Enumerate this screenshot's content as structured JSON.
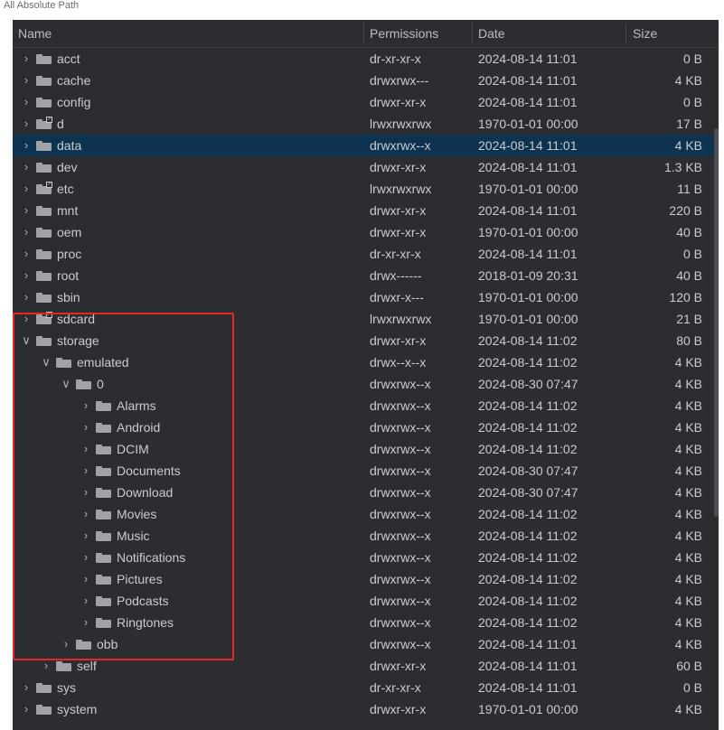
{
  "window": {
    "top_text": "All  Absolute  Path"
  },
  "columns": {
    "name": "Name",
    "permissions": "Permissions",
    "date": "Date",
    "size": "Size"
  },
  "rows": [
    {
      "name": "acct",
      "depth": 0,
      "expanded": false,
      "symlink": false,
      "perm": "dr-xr-xr-x",
      "date": "2024-08-14 11:01",
      "size": "0 B"
    },
    {
      "name": "cache",
      "depth": 0,
      "expanded": false,
      "symlink": false,
      "perm": "drwxrwx---",
      "date": "2024-08-14 11:01",
      "size": "4 KB"
    },
    {
      "name": "config",
      "depth": 0,
      "expanded": false,
      "symlink": false,
      "perm": "drwxr-xr-x",
      "date": "2024-08-14 11:01",
      "size": "0 B"
    },
    {
      "name": "d",
      "depth": 0,
      "expanded": false,
      "symlink": true,
      "perm": "lrwxrwxrwx",
      "date": "1970-01-01 00:00",
      "size": "17 B"
    },
    {
      "name": "data",
      "depth": 0,
      "expanded": false,
      "symlink": false,
      "perm": "drwxrwx--x",
      "date": "2024-08-14 11:01",
      "size": "4 KB",
      "selected": true
    },
    {
      "name": "dev",
      "depth": 0,
      "expanded": false,
      "symlink": false,
      "perm": "drwxr-xr-x",
      "date": "2024-08-14 11:01",
      "size": "1.3 KB"
    },
    {
      "name": "etc",
      "depth": 0,
      "expanded": false,
      "symlink": true,
      "perm": "lrwxrwxrwx",
      "date": "1970-01-01 00:00",
      "size": "11 B"
    },
    {
      "name": "mnt",
      "depth": 0,
      "expanded": false,
      "symlink": false,
      "perm": "drwxr-xr-x",
      "date": "2024-08-14 11:01",
      "size": "220 B"
    },
    {
      "name": "oem",
      "depth": 0,
      "expanded": false,
      "symlink": false,
      "perm": "drwxr-xr-x",
      "date": "1970-01-01 00:00",
      "size": "40 B"
    },
    {
      "name": "proc",
      "depth": 0,
      "expanded": false,
      "symlink": false,
      "perm": "dr-xr-xr-x",
      "date": "2024-08-14 11:01",
      "size": "0 B"
    },
    {
      "name": "root",
      "depth": 0,
      "expanded": false,
      "symlink": false,
      "perm": "drwx------",
      "date": "2018-01-09 20:31",
      "size": "40 B"
    },
    {
      "name": "sbin",
      "depth": 0,
      "expanded": false,
      "symlink": false,
      "perm": "drwxr-x---",
      "date": "1970-01-01 00:00",
      "size": "120 B"
    },
    {
      "name": "sdcard",
      "depth": 0,
      "expanded": false,
      "symlink": true,
      "perm": "lrwxrwxrwx",
      "date": "1970-01-01 00:00",
      "size": "21 B"
    },
    {
      "name": "storage",
      "depth": 0,
      "expanded": true,
      "symlink": false,
      "perm": "drwxr-xr-x",
      "date": "2024-08-14 11:02",
      "size": "80 B"
    },
    {
      "name": "emulated",
      "depth": 1,
      "expanded": true,
      "symlink": false,
      "perm": "drwx--x--x",
      "date": "2024-08-14 11:02",
      "size": "4 KB"
    },
    {
      "name": "0",
      "depth": 2,
      "expanded": true,
      "symlink": false,
      "perm": "drwxrwx--x",
      "date": "2024-08-30 07:47",
      "size": "4 KB"
    },
    {
      "name": "Alarms",
      "depth": 3,
      "expanded": false,
      "symlink": false,
      "perm": "drwxrwx--x",
      "date": "2024-08-14 11:02",
      "size": "4 KB"
    },
    {
      "name": "Android",
      "depth": 3,
      "expanded": false,
      "symlink": false,
      "perm": "drwxrwx--x",
      "date": "2024-08-14 11:02",
      "size": "4 KB"
    },
    {
      "name": "DCIM",
      "depth": 3,
      "expanded": false,
      "symlink": false,
      "perm": "drwxrwx--x",
      "date": "2024-08-14 11:02",
      "size": "4 KB"
    },
    {
      "name": "Documents",
      "depth": 3,
      "expanded": false,
      "symlink": false,
      "perm": "drwxrwx--x",
      "date": "2024-08-30 07:47",
      "size": "4 KB"
    },
    {
      "name": "Download",
      "depth": 3,
      "expanded": false,
      "symlink": false,
      "perm": "drwxrwx--x",
      "date": "2024-08-30 07:47",
      "size": "4 KB"
    },
    {
      "name": "Movies",
      "depth": 3,
      "expanded": false,
      "symlink": false,
      "perm": "drwxrwx--x",
      "date": "2024-08-14 11:02",
      "size": "4 KB"
    },
    {
      "name": "Music",
      "depth": 3,
      "expanded": false,
      "symlink": false,
      "perm": "drwxrwx--x",
      "date": "2024-08-14 11:02",
      "size": "4 KB"
    },
    {
      "name": "Notifications",
      "depth": 3,
      "expanded": false,
      "symlink": false,
      "perm": "drwxrwx--x",
      "date": "2024-08-14 11:02",
      "size": "4 KB"
    },
    {
      "name": "Pictures",
      "depth": 3,
      "expanded": false,
      "symlink": false,
      "perm": "drwxrwx--x",
      "date": "2024-08-14 11:02",
      "size": "4 KB"
    },
    {
      "name": "Podcasts",
      "depth": 3,
      "expanded": false,
      "symlink": false,
      "perm": "drwxrwx--x",
      "date": "2024-08-14 11:02",
      "size": "4 KB"
    },
    {
      "name": "Ringtones",
      "depth": 3,
      "expanded": false,
      "symlink": false,
      "perm": "drwxrwx--x",
      "date": "2024-08-14 11:02",
      "size": "4 KB"
    },
    {
      "name": "obb",
      "depth": 2,
      "expanded": false,
      "symlink": false,
      "perm": "drwxrwx--x",
      "date": "2024-08-14 11:01",
      "size": "4 KB"
    },
    {
      "name": "self",
      "depth": 1,
      "expanded": false,
      "symlink": false,
      "perm": "drwxr-xr-x",
      "date": "2024-08-14 11:01",
      "size": "60 B"
    },
    {
      "name": "sys",
      "depth": 0,
      "expanded": false,
      "symlink": false,
      "perm": "dr-xr-xr-x",
      "date": "2024-08-14 11:01",
      "size": "0 B"
    },
    {
      "name": "system",
      "depth": 0,
      "expanded": false,
      "symlink": false,
      "perm": "drwxr-xr-x",
      "date": "1970-01-01 00:00",
      "size": "4 KB"
    }
  ],
  "colors": {
    "panel_bg": "#2b2d30",
    "selected_row": "#0d3350",
    "highlight_box": "#e8262a"
  }
}
